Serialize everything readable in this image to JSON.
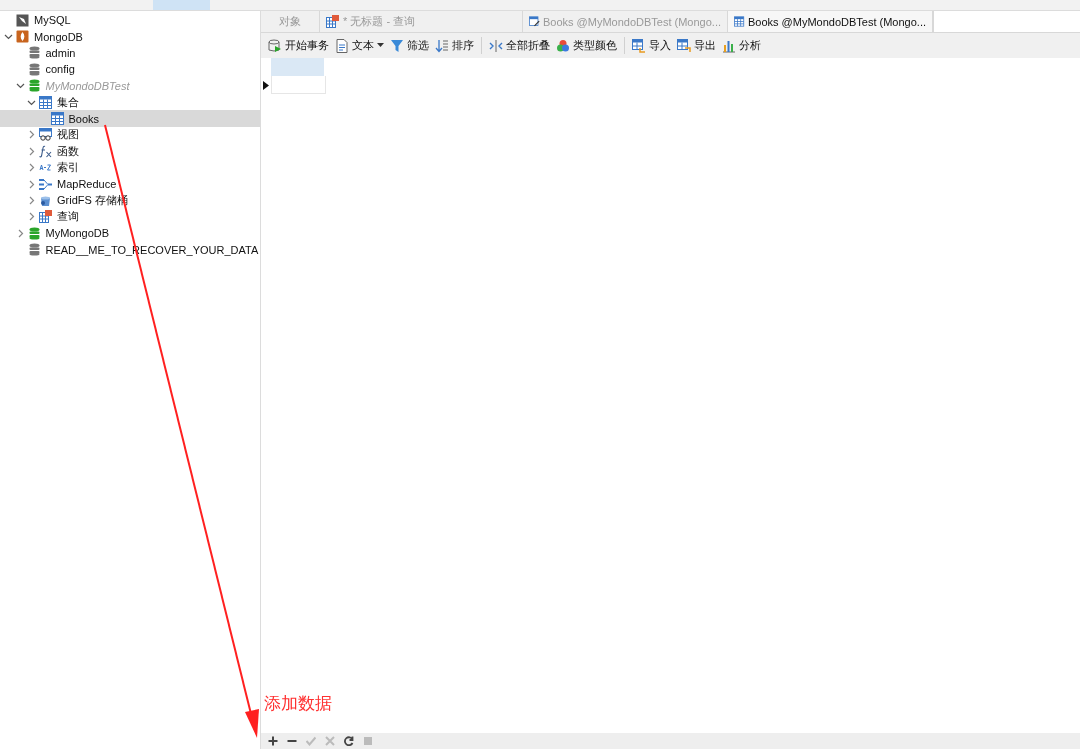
{
  "tree": [
    {
      "label": "MySQL",
      "kind": "mysql"
    },
    {
      "label": "MongoDB",
      "kind": "mongodb",
      "expanded": true,
      "children": [
        {
          "label": "admin",
          "kind": "database"
        },
        {
          "label": "config",
          "kind": "database"
        },
        {
          "label": "MyMondoDBTest",
          "kind": "database-open",
          "dimmed": true,
          "expanded": true,
          "children": [
            {
              "label": "集合",
              "kind": "table",
              "expanded": true,
              "children": [
                {
                  "label": "Books",
                  "kind": "table",
                  "selected": true
                }
              ]
            },
            {
              "label": "视图",
              "kind": "view",
              "expanded": false
            },
            {
              "label": "函数",
              "kind": "function",
              "expanded": false
            },
            {
              "label": "索引",
              "kind": "index",
              "expanded": false
            },
            {
              "label": "MapReduce",
              "kind": "mapreduce",
              "expanded": false
            },
            {
              "label": "GridFS 存储桶",
              "kind": "gridfs",
              "expanded": false
            },
            {
              "label": "查询",
              "kind": "query",
              "expanded": false
            }
          ]
        },
        {
          "label": "MyMongoDB",
          "kind": "database-open",
          "dimmed": false,
          "expanded": false
        },
        {
          "label": "READ__ME_TO_RECOVER_YOUR_DATA",
          "kind": "database"
        }
      ]
    }
  ],
  "tabs": [
    {
      "label": "对象",
      "kind": "plain",
      "selected": false
    },
    {
      "label": "* 无标题 - 查询",
      "kind": "query",
      "selected": false
    },
    {
      "label": "Books @MyMondoDBTest (Mongo...",
      "kind": "edit",
      "selected": false
    },
    {
      "label": "Books @MyMondoDBTest (Mongo...",
      "kind": "table",
      "selected": true
    }
  ],
  "toolbar": [
    [
      {
        "label": "开始事务",
        "kind": "transaction"
      },
      {
        "label": "文本",
        "kind": "text",
        "dropdown": true
      },
      {
        "label": "筛选",
        "kind": "filter"
      },
      {
        "label": "排序",
        "kind": "sort"
      }
    ],
    [
      {
        "label": "全部折叠",
        "kind": "collapse"
      },
      {
        "label": "类型颜色",
        "kind": "color"
      }
    ],
    [
      {
        "label": "导入",
        "kind": "import"
      },
      {
        "label": "导出",
        "kind": "export"
      },
      {
        "label": "分析",
        "kind": "chart"
      }
    ]
  ],
  "bottom_bar": [
    {
      "kind": "add",
      "disabled": false
    },
    {
      "kind": "remove",
      "disabled": false
    },
    {
      "kind": "apply",
      "disabled": true
    },
    {
      "kind": "cancel",
      "disabled": true
    },
    {
      "kind": "refresh",
      "disabled": false
    },
    {
      "kind": "stop",
      "disabled": true
    }
  ],
  "annotation": {
    "label": "添加数据"
  }
}
